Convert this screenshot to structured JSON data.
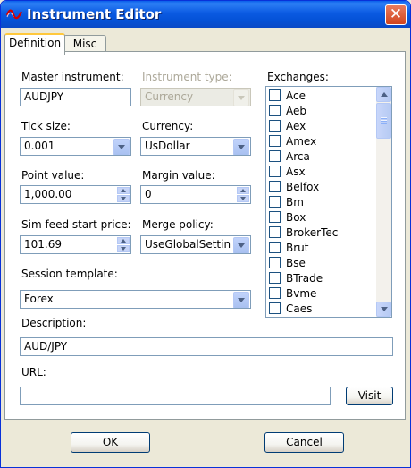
{
  "window": {
    "title": "Instrument Editor",
    "close_glyph": "✕"
  },
  "tabs": [
    "Definition",
    "Misc"
  ],
  "form": {
    "master_instrument": {
      "label": "Master instrument:",
      "value": "AUDJPY"
    },
    "instrument_type": {
      "label": "Instrument type:",
      "value": "Currency"
    },
    "tick_size": {
      "label": "Tick size:",
      "value": "0.001"
    },
    "currency": {
      "label": "Currency:",
      "value": "UsDollar"
    },
    "point_value": {
      "label": "Point value:",
      "value": "1,000.00"
    },
    "margin_value": {
      "label": "Margin value:",
      "value": "0"
    },
    "sim_feed_start_price": {
      "label": "Sim feed start price:",
      "value": "101.69"
    },
    "merge_policy": {
      "label": "Merge policy:",
      "value": "UseGlobalSettin"
    },
    "session_template": {
      "label": "Session template:",
      "value": "Forex"
    },
    "description": {
      "label": "Description:",
      "value": "AUD/JPY"
    },
    "url": {
      "label": "URL:",
      "value": ""
    },
    "visit_label": "Visit"
  },
  "exchanges": {
    "label": "Exchanges:",
    "items": [
      "Ace",
      "Aeb",
      "Aex",
      "Amex",
      "Arca",
      "Asx",
      "Belfox",
      "Bm",
      "Box",
      "BrokerTec",
      "Brut",
      "Bse",
      "BTrade",
      "Bvme",
      "Caes"
    ]
  },
  "footer": {
    "ok_label": "OK",
    "cancel_label": "Cancel"
  },
  "icons": {
    "app": "instrument-editor-app-icon",
    "close": "close-icon"
  },
  "colors": {
    "titlebar": "#0553D8",
    "face": "#ECE9D8",
    "close": "#D2451E",
    "field_border": "#7F9DB9"
  }
}
